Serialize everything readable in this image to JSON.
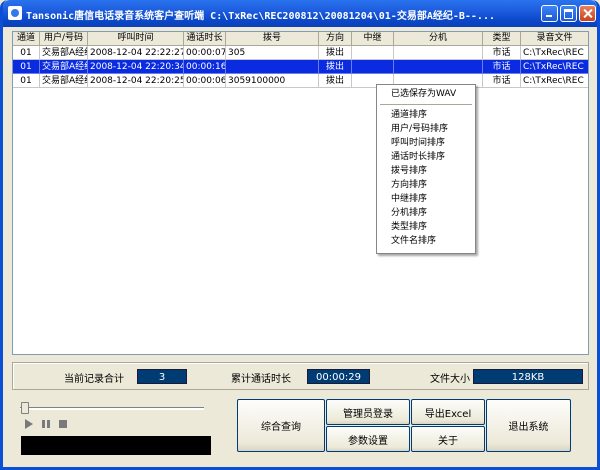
{
  "window": {
    "title": "Tansonic唐信电话录音系统客户查听端   C:\\TxRec\\REC200812\\20081204\\01-交易部A经纪-B--..."
  },
  "table": {
    "columns": [
      "通道",
      "用户/号码",
      "呼叫时间",
      "通话时长",
      "拨号",
      "方向",
      "中继",
      "分机",
      "类型",
      "录音文件"
    ],
    "rows": [
      {
        "cells": [
          "01",
          "交易部A经纪",
          "2008-12-04 22:22:27",
          "00:00:07",
          "305",
          "拨出",
          "",
          "",
          "市话",
          "C:\\TxRec\\REC"
        ],
        "selected": false
      },
      {
        "cells": [
          "01",
          "交易部A经纪",
          "2008-12-04 22:20:34",
          "00:00:16",
          "",
          "拨出",
          "",
          "",
          "市话",
          "C:\\TxRec\\REC"
        ],
        "selected": true
      },
      {
        "cells": [
          "01",
          "交易部A经纪",
          "2008-12-04 22:20:25",
          "00:00:06",
          "3059100000",
          "拨出",
          "",
          "",
          "市话",
          "C:\\TxRec\\REC"
        ],
        "selected": false
      }
    ]
  },
  "context_menu": {
    "items": [
      "已选保存为WAV",
      "通道排序",
      "用户/号码排序",
      "呼叫时间排序",
      "通话时长排序",
      "拨号排序",
      "方向排序",
      "中继排序",
      "分机排序",
      "类型排序",
      "文件名排序"
    ]
  },
  "stats": {
    "record_count_label": "当前记录合计",
    "record_count": "3",
    "total_duration_label": "累计通话时长",
    "total_duration": "00:00:29",
    "file_size_label": "文件大小",
    "file_size": "128KB"
  },
  "buttons": {
    "query": "综合查询",
    "admin_login": "管理员登录",
    "export_excel": "导出Excel",
    "settings": "参数设置",
    "about": "关于",
    "exit": "退出系统"
  },
  "colors": {
    "titlebar": "#0a48c9",
    "selection": "#0a2be0",
    "value_box": "#003c74"
  }
}
